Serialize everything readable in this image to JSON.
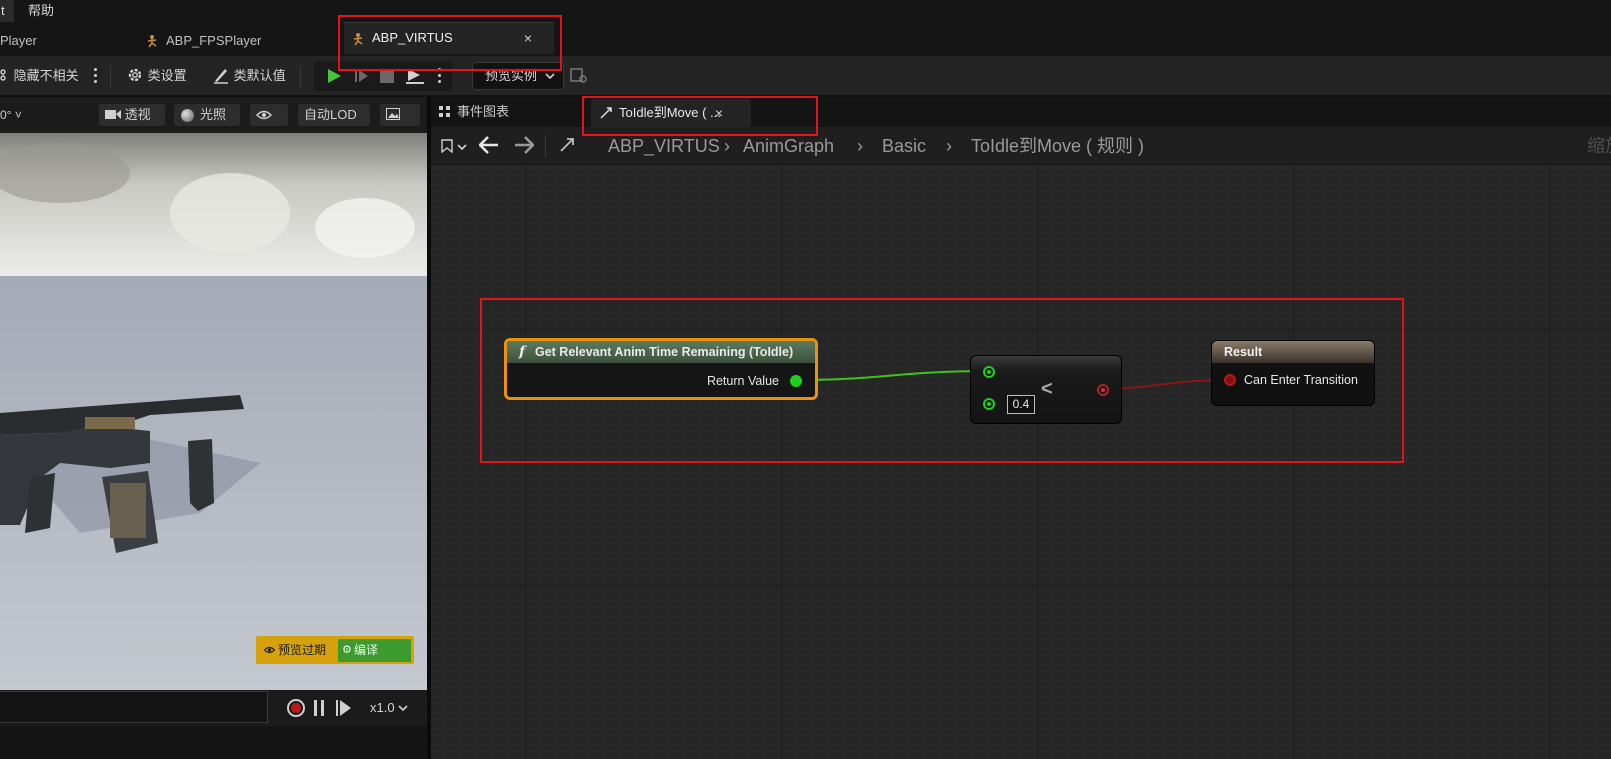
{
  "menu": {
    "left_fragment": "t",
    "help": "帮助"
  },
  "tabs": {
    "player": "Player",
    "fps": "ABP_FPSPlayer",
    "virtus": "ABP_VIRTUS",
    "close": "×"
  },
  "toolbar": {
    "hide_unrelated": "隐藏不相关",
    "class_settings": "类设置",
    "class_defaults": "类默认值",
    "preview_instance": "预览实例"
  },
  "viewport": {
    "fov": "0°",
    "perspective": "透视",
    "lighting": "光照",
    "lod": "自动LOD",
    "stale_preview": "预览过期",
    "compile": "编译",
    "speed": "x1.0"
  },
  "graph_tabs": {
    "event_graph": "事件图表",
    "rule_tab": "ToIdle到Move ( ...",
    "close": "×"
  },
  "breadcrumb": {
    "items": [
      "ABP_VIRTUS",
      "AnimGraph",
      "Basic",
      "ToIdle到Move ( 规则 )"
    ],
    "zoom": "缩放"
  },
  "nodes": {
    "get_time": {
      "title": "Get Relevant Anim Time Remaining (ToIdle)",
      "output": "Return Value"
    },
    "less": {
      "operator": "<",
      "constant": "0.4"
    },
    "result": {
      "title": "Result",
      "input": "Can Enter Transition"
    }
  },
  "colors": {
    "annotation": "#e0141c",
    "exec_wire_float": "#3fc21a",
    "bool_wire": "#8a1616",
    "selected_node": "#e8920e"
  }
}
